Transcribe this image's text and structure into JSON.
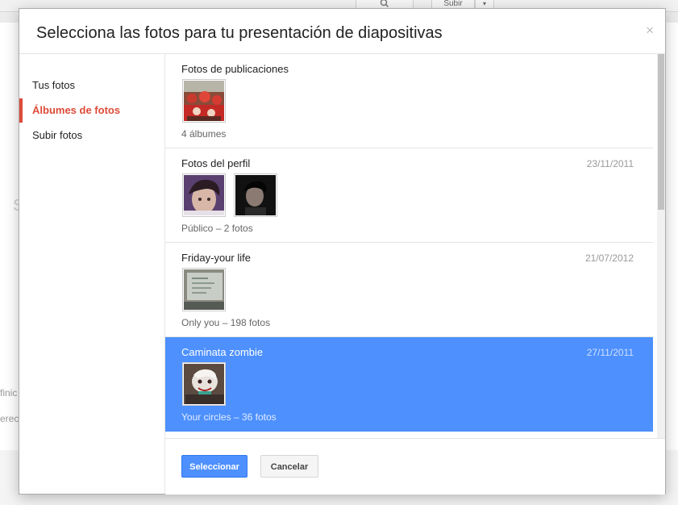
{
  "background": {
    "upload_label": "Subir",
    "caret": "▾",
    "fragment_s": "S",
    "fragment_1": "finic",
    "fragment_2": "erech"
  },
  "dialog": {
    "title": "Selecciona las fotos para tu presentación de diapositivas",
    "close": "×"
  },
  "sidebar": {
    "items": [
      {
        "label": "Tus fotos",
        "active": false
      },
      {
        "label": "Álbumes de fotos",
        "active": true
      },
      {
        "label": "Subir fotos",
        "active": false
      }
    ]
  },
  "albums": [
    {
      "name": "Fotos de publicaciones",
      "date": "",
      "meta": "4 álbumes",
      "thumbs": 1,
      "selected": false
    },
    {
      "name": "Fotos del perfil",
      "date": "23/11/2011",
      "meta": "Público – 2 fotos",
      "thumbs": 2,
      "selected": false
    },
    {
      "name": "Friday-your life",
      "date": "21/07/2012",
      "meta": "Only you – 198 fotos",
      "thumbs": 1,
      "selected": false
    },
    {
      "name": "Caminata zombie",
      "date": "27/11/2011",
      "meta": "Your circles – 36 fotos",
      "thumbs": 1,
      "selected": true
    }
  ],
  "footer": {
    "select_label": "Seleccionar",
    "cancel_label": "Cancelar"
  },
  "colors": {
    "accent_blue": "#4d90fe",
    "active_red": "#dd4b39"
  }
}
